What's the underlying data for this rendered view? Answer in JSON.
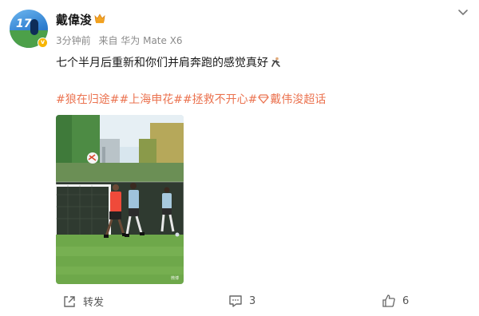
{
  "post": {
    "username": "戴偉浚",
    "time": "3分钟前",
    "source": "来自 华为 Mate X6",
    "text": "七个半月后重新和你们并肩奔跑的感觉真好",
    "hashtags": [
      "#狼在归途#",
      "#上海申花#",
      "#拯救不开心#"
    ],
    "super_topic": "戴伟浚超话",
    "watermark": "微博",
    "avatar_number": "17"
  },
  "actions": {
    "repost_label": "转发",
    "comment_count": "3",
    "like_count": "6"
  },
  "icons": {
    "crown": "crown-emoji-icon",
    "runner": "runner-emoji-icon",
    "gem": "diamond-icon",
    "more": "chevron-down-icon",
    "repost": "repost-icon",
    "comment": "comment-icon",
    "like": "thumbs-up-icon"
  },
  "colors": {
    "hashtag": "#eb7350",
    "meta": "#8a8a8a",
    "verified": "#f7b500"
  }
}
